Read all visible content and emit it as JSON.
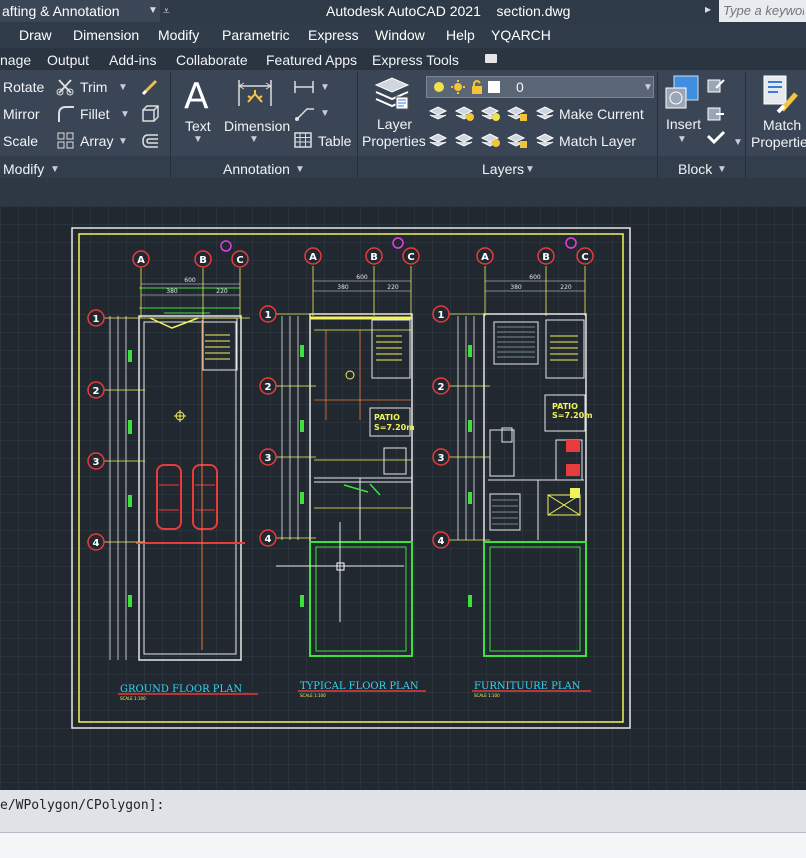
{
  "titlebar": {
    "workspace": "afting & Annotation",
    "app_title": "Autodesk AutoCAD 2021    section.dwg",
    "search_placeholder": "Type a keyword"
  },
  "menubar": [
    "Draw",
    "Dimension",
    "Modify",
    "Parametric",
    "Express",
    "Window",
    "Help",
    "YQARCH"
  ],
  "ribbon_tabs": [
    "nage",
    "Output",
    "Add-ins",
    "Collaborate",
    "Featured Apps",
    "Express Tools"
  ],
  "ribbon": {
    "modify": {
      "rotate": "Rotate",
      "trim": "Trim",
      "mirror": "Mirror",
      "fillet": "Fillet",
      "scale": "Scale",
      "array": "Array",
      "panel": "Modify"
    },
    "annotation": {
      "text": "Text",
      "dimension": "Dimension",
      "table": "Table",
      "panel": "Annotation"
    },
    "layers": {
      "layer_properties_1": "Layer",
      "layer_properties_2": "Properties",
      "current_layer": "0",
      "make_current": "Make Current",
      "match_layer": "Match Layer",
      "panel": "Layers"
    },
    "block": {
      "insert": "Insert",
      "panel": "Block"
    },
    "properties": {
      "match_1": "Match",
      "match_2": "Propertie"
    }
  },
  "drawing": {
    "grid_letters": [
      "A",
      "B",
      "C"
    ],
    "grid_numbers": [
      "1",
      "2",
      "3",
      "4"
    ],
    "dim_total": "600",
    "dim_a": "380",
    "dim_b": "220",
    "patio": "PATIO",
    "patio_area": "S=7.20m",
    "titles": [
      "GROUND FLOOR PLAN",
      "TYPICAL FLOOR PLAN",
      "FURNITUURE PLAN"
    ],
    "scale_text": "SCALE 1:100"
  },
  "command_line": {
    "prompt": "e/WPolygon/CPolygon]:"
  },
  "colors": {
    "accent_yellow": "#f2f25a",
    "grid_red": "#e83b3b",
    "cyan": "#33d6f2",
    "magenta": "#e040e0",
    "green": "#3de03d"
  }
}
